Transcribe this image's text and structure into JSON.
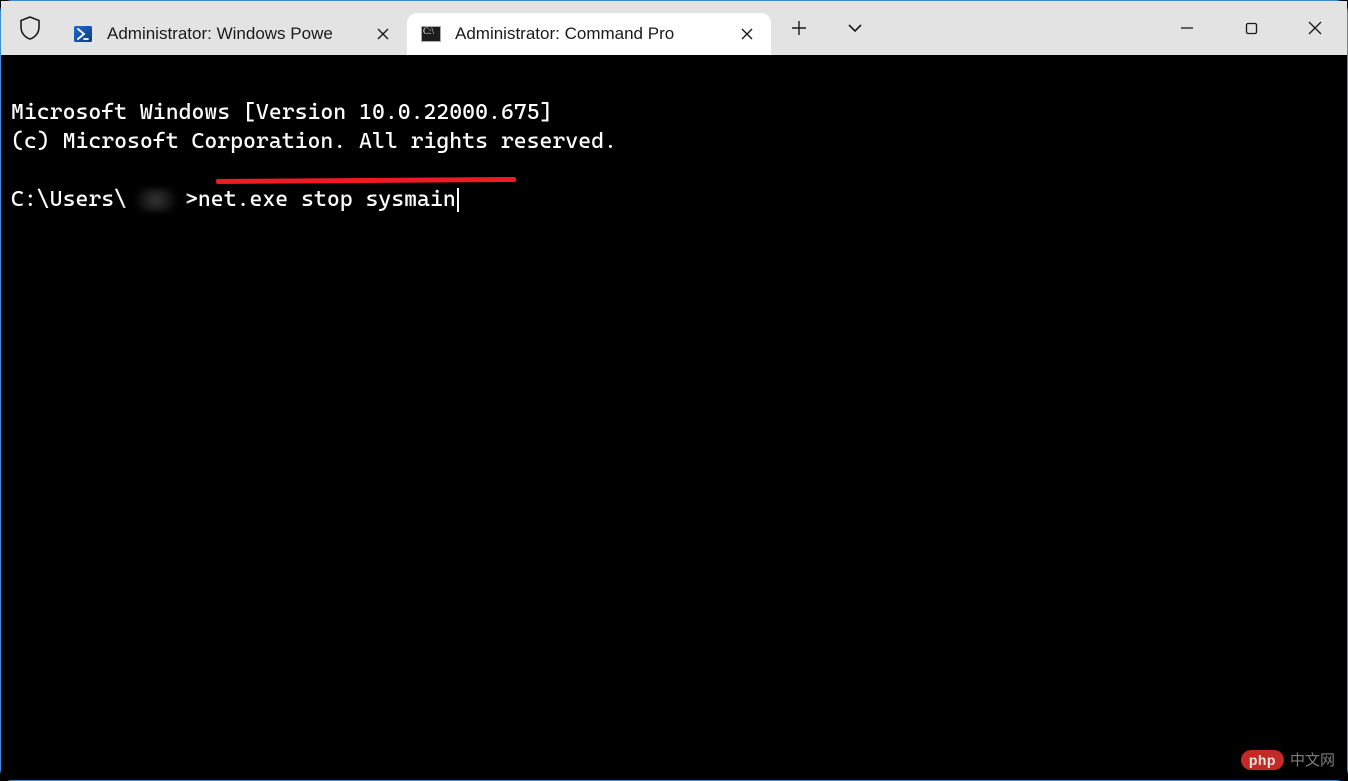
{
  "titlebar": {
    "tabs": [
      {
        "label": "Administrator: Windows Powe",
        "icon": "powershell-icon",
        "active": false
      },
      {
        "label": "Administrator: Command Pro",
        "icon": "cmd-icon",
        "active": true
      }
    ],
    "new_tab_tooltip": "New tab",
    "dropdown_tooltip": "New tab dropdown"
  },
  "terminal": {
    "banner_line1": "Microsoft Windows [Version 10.0.22000.675]",
    "banner_line2": "(c) Microsoft Corporation. All rights reserved.",
    "prompt_prefix": "C:\\Users\\",
    "prompt_user_redacted": true,
    "prompt_sep": ">",
    "command": "net.exe stop sysmain"
  },
  "annotation": {
    "underline_color": "#ee1b24"
  },
  "watermark": {
    "badge": "php",
    "text": "中文网"
  }
}
